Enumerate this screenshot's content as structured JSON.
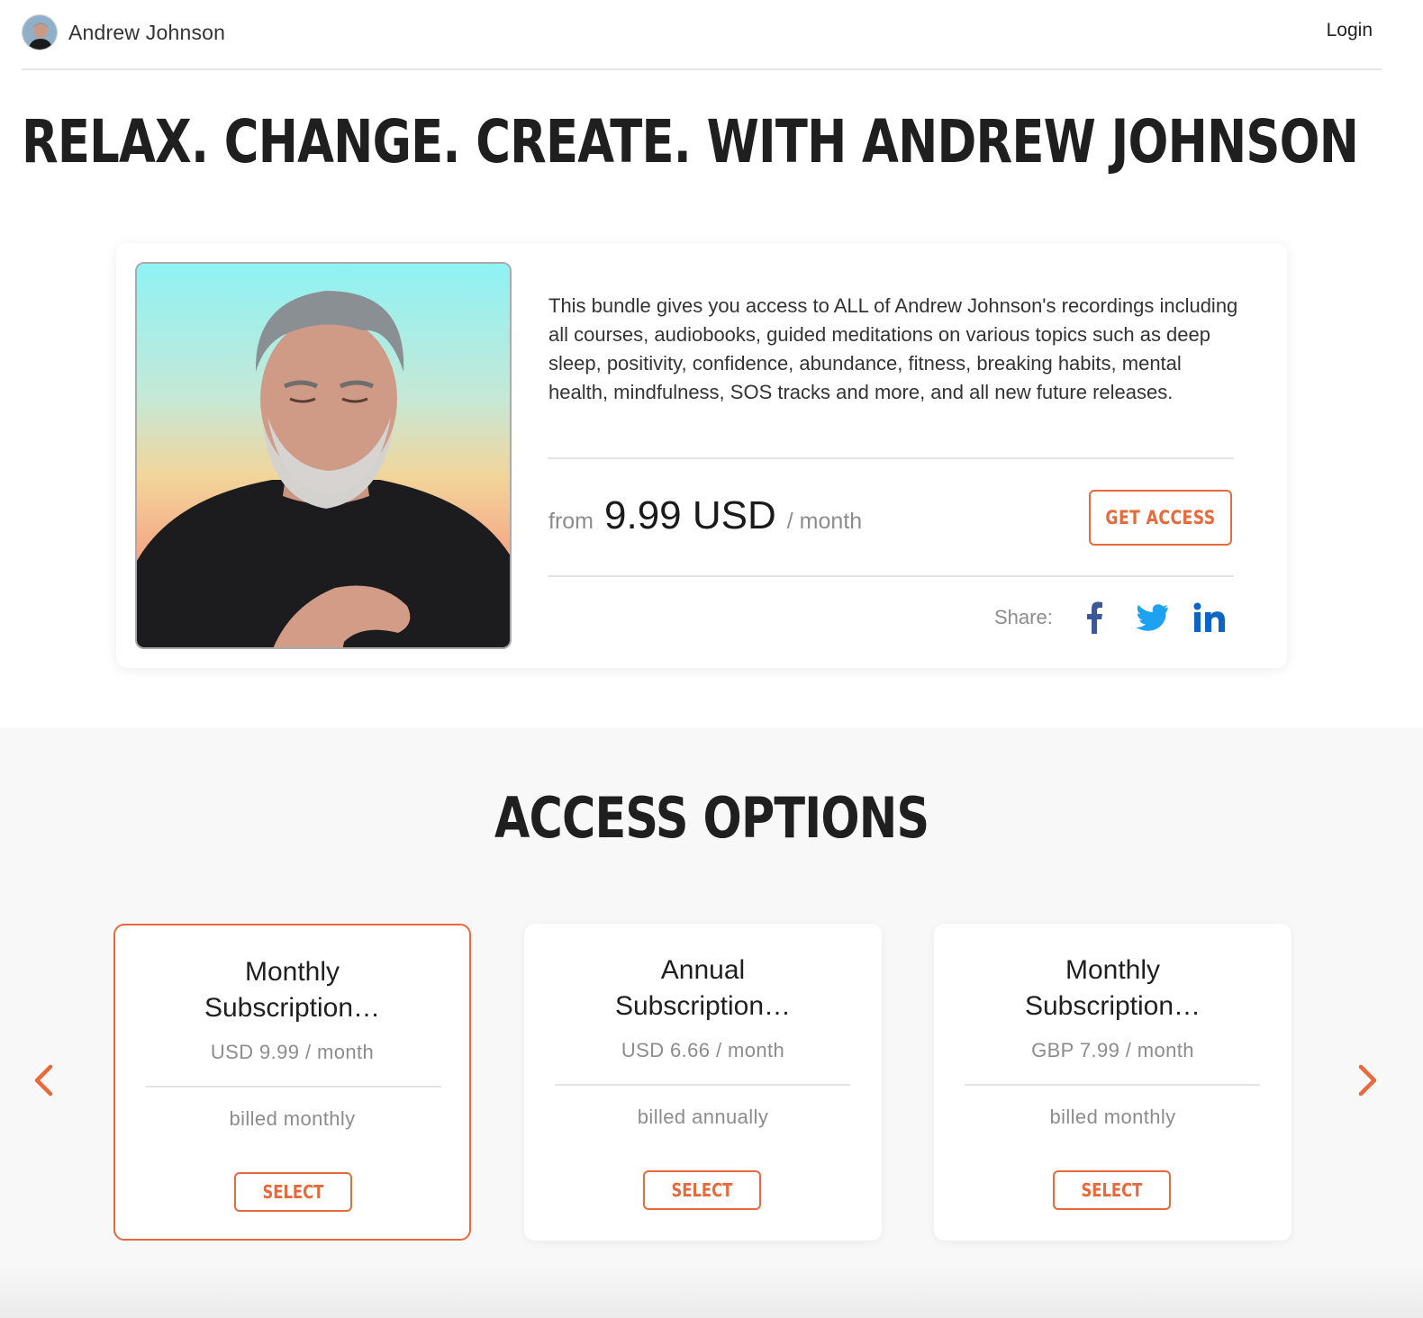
{
  "header": {
    "brand_name": "Andrew Johnson",
    "login_label": "Login"
  },
  "page_title": "RELAX. CHANGE. CREATE. WITH ANDREW JOHNSON",
  "product": {
    "description": "This bundle gives you access to ALL of Andrew Johnson's recordings including all courses, audiobooks, guided meditations on various topics such as deep sleep, positivity, confidence, abundance, fitness, breaking habits, mental health, mindfulness, SOS tracks and more, and all new future releases.",
    "price_from": "from",
    "price_amount": "9.99 USD",
    "price_period": "/ month",
    "cta_label": "GET ACCESS",
    "share_label": "Share:",
    "share_icons": [
      "facebook-icon",
      "twitter-icon",
      "linkedin-icon"
    ]
  },
  "options": {
    "title": "ACCESS OPTIONS",
    "plans": [
      {
        "name_line1": "Monthly",
        "name_line2": "Subscription…",
        "price": "USD 9.99 / month",
        "billing": "billed monthly",
        "select_label": "SELECT",
        "selected": true
      },
      {
        "name_line1": "Annual",
        "name_line2": "Subscription…",
        "price": "USD 6.66 / month",
        "billing": "billed annually",
        "select_label": "SELECT",
        "selected": false
      },
      {
        "name_line1": "Monthly",
        "name_line2": "Subscription…",
        "price": "GBP 7.99 / month",
        "billing": "billed monthly",
        "select_label": "SELECT",
        "selected": false
      }
    ],
    "prev_icon": "chevron-left-icon",
    "next_icon": "chevron-right-icon"
  },
  "colors": {
    "accent": "#e8693b",
    "facebook": "#3b5998",
    "twitter": "#1da1f2",
    "linkedin": "#0a66c2"
  }
}
